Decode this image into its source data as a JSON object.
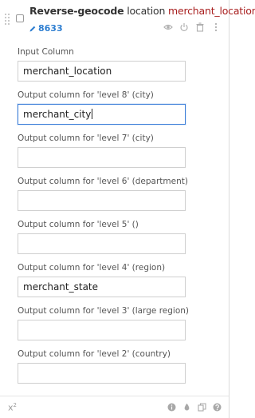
{
  "step": {
    "title_bold": "Reverse-geocode",
    "title_plain": " location ",
    "title_column": "merchant_location",
    "count": "8633",
    "icons": [
      "eye-icon",
      "power-icon",
      "trash-icon",
      "more-icon"
    ]
  },
  "fields": [
    {
      "label": "Input Column",
      "value": "merchant_location",
      "focused": false
    },
    {
      "label": "Output column for 'level 8' (city)",
      "value": "merchant_city",
      "focused": true
    },
    {
      "label": "Output column for 'level 7' (city)",
      "value": "",
      "focused": false
    },
    {
      "label": "Output column for 'level 6' (department)",
      "value": "",
      "focused": false
    },
    {
      "label": "Output column for 'level 5' ()",
      "value": "",
      "focused": false
    },
    {
      "label": "Output column for 'level 4' (region)",
      "value": "merchant_state",
      "focused": false
    },
    {
      "label": "Output column for 'level 3' (large region)",
      "value": "",
      "focused": false
    },
    {
      "label": "Output column for 'level 2' (country)",
      "value": "",
      "focused": false
    }
  ],
  "footer": {
    "formula_base": "x",
    "formula_exp": "2",
    "icons": [
      "info-icon",
      "drop-icon",
      "copy-icon",
      "help-icon"
    ]
  },
  "colors": {
    "accent": "#2f7fd1",
    "column_name": "#a81f1f",
    "focus_border": "#3b7dd8"
  }
}
